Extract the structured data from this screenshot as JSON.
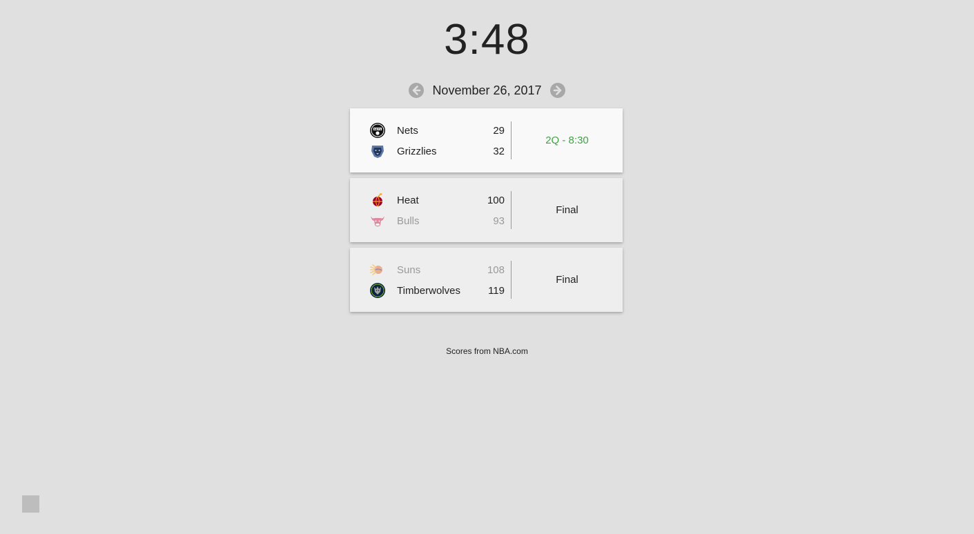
{
  "clock": {
    "time": "3:48"
  },
  "date_nav": {
    "date": "November 26, 2017",
    "prev_icon": "arrow-left-circle-icon",
    "next_icon": "arrow-right-circle-icon"
  },
  "games": [
    {
      "status": "2Q - 8:30",
      "status_type": "live",
      "away": {
        "name": "Nets",
        "score": "29",
        "logo": "nets-logo-icon",
        "winner": true
      },
      "home": {
        "name": "Grizzlies",
        "score": "32",
        "logo": "grizzlies-logo-icon",
        "winner": true
      }
    },
    {
      "status": "Final",
      "status_type": "final",
      "away": {
        "name": "Heat",
        "score": "100",
        "logo": "heat-logo-icon",
        "winner": true
      },
      "home": {
        "name": "Bulls",
        "score": "93",
        "logo": "bulls-logo-icon",
        "winner": false
      }
    },
    {
      "status": "Final",
      "status_type": "final",
      "away": {
        "name": "Suns",
        "score": "108",
        "logo": "suns-logo-icon",
        "winner": false
      },
      "home": {
        "name": "Timberwolves",
        "score": "119",
        "logo": "timberwolves-logo-icon",
        "winner": true
      }
    }
  ],
  "footer": {
    "credit": "Scores from NBA.com"
  },
  "colors": {
    "background": "#e0e0e0",
    "live_status": "#43a047",
    "loser_text": "#9a9a9a",
    "nav_button": "#a8a8a8"
  }
}
